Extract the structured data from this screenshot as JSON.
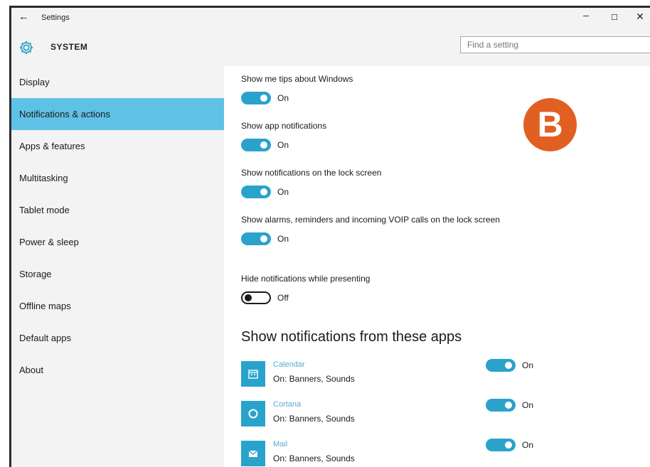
{
  "window": {
    "title": "Settings",
    "back_icon": "back-arrow-icon",
    "minimize": "–",
    "maximize": "☐",
    "close": "✕"
  },
  "header": {
    "section": "SYSTEM",
    "icon": "gear-icon",
    "search_placeholder": "Find a setting",
    "search_icon": "search-icon"
  },
  "sidebar": {
    "active_index": 1,
    "items": [
      {
        "label": "Display"
      },
      {
        "label": "Notifications & actions"
      },
      {
        "label": "Apps & features"
      },
      {
        "label": "Multitasking"
      },
      {
        "label": "Tablet mode"
      },
      {
        "label": "Power & sleep"
      },
      {
        "label": "Storage"
      },
      {
        "label": "Offline maps"
      },
      {
        "label": "Default apps"
      },
      {
        "label": "About"
      }
    ]
  },
  "settings": [
    {
      "label": "Show me tips about Windows",
      "state": "On",
      "enabled": true
    },
    {
      "label": "Show app notifications",
      "state": "On",
      "enabled": true
    },
    {
      "label": "Show notifications on the lock screen",
      "state": "On",
      "enabled": true
    },
    {
      "label": "Show alarms, reminders and incoming VOIP calls on the lock screen",
      "state": "On",
      "enabled": true
    },
    {
      "label": "Hide notifications while presenting",
      "state": "Off",
      "enabled": false
    }
  ],
  "badge": {
    "letter": "B",
    "color": "#e25f22"
  },
  "apps_section": {
    "heading": "Show notifications from these apps",
    "apps": [
      {
        "name": "Calendar",
        "status": "On: Banners, Sounds",
        "state": "On",
        "icon": "calendar-icon"
      },
      {
        "name": "Cortana",
        "status": "On: Banners, Sounds",
        "state": "On",
        "icon": "cortana-icon"
      },
      {
        "name": "Mail",
        "status": "On: Banners, Sounds",
        "state": "On",
        "icon": "mail-icon"
      }
    ]
  },
  "colors": {
    "accent": "#2aa3cc",
    "sidebar_active": "#5fc1e5",
    "sidebar_bg": "#f3f3f3",
    "badge": "#e25f22"
  }
}
